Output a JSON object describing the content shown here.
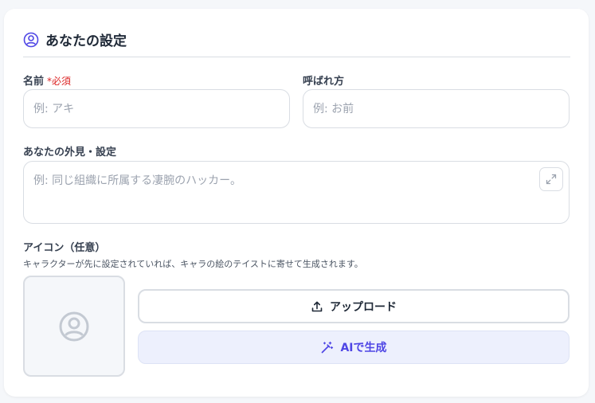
{
  "section": {
    "title": "あなたの設定",
    "icon": "user-circle-icon"
  },
  "name_field": {
    "label": "名前",
    "required": "*必須",
    "placeholder": "例: アキ"
  },
  "nickname_field": {
    "label": "呼ばれ方",
    "placeholder": "例: お前"
  },
  "appearance_field": {
    "label": "あなたの外見・設定",
    "placeholder": "例: 同じ組織に所属する凄腕のハッカー。",
    "expand_icon": "expand-icon"
  },
  "icon_section": {
    "label": "アイコン（任意）",
    "description": "キャラクターが先に設定されていれば、キャラの絵のテイストに寄せて生成されます。",
    "avatar_icon": "user-circle-icon",
    "upload_label": "アップロード",
    "upload_icon": "upload-icon",
    "ai_label": "AIで生成",
    "ai_icon": "magic-wand-icon"
  },
  "colors": {
    "accent": "#4f46e5",
    "required": "#dc2626",
    "border": "#d9dde3"
  }
}
